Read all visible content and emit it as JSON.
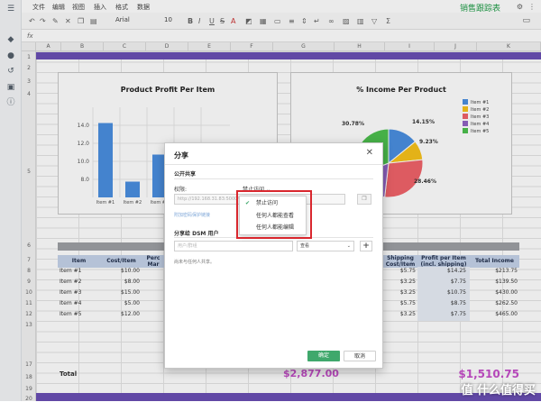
{
  "app": {
    "doc_title": "销售跟踪表"
  },
  "menu": [
    "文件",
    "编辑",
    "视图",
    "插入",
    "格式",
    "数据"
  ],
  "toolbar": {
    "font": "Arial",
    "size": "10"
  },
  "formula_bar": {
    "fx": "fx"
  },
  "columns": [
    "A",
    "B",
    "C",
    "D",
    "E",
    "F",
    "G",
    "H",
    "I",
    "J",
    "K"
  ],
  "rows": [
    "1",
    "2",
    "3",
    "4",
    "5",
    "6",
    "7",
    "8",
    "9",
    "10",
    "11",
    "12",
    "13",
    "17",
    "18",
    "19",
    "20"
  ],
  "chart_left": {
    "title": "Product Profit Per Item",
    "chart_data": {
      "type": "bar",
      "categories": [
        "Item #1",
        "Item #2",
        "Item #3"
      ],
      "values": [
        14.25,
        7.75,
        10.75
      ],
      "ylim": [
        6,
        16
      ],
      "yticks": [
        "14.0",
        "12.0",
        "10.0",
        "8.0"
      ],
      "color": "#4a8fe0"
    }
  },
  "chart_right": {
    "title": "% Income Per Product",
    "chart_data": {
      "type": "pie",
      "labels": [
        "Item #1",
        "Item #2",
        "Item #3",
        "Item #4",
        "Item #5"
      ],
      "values": [
        14.15,
        9.23,
        28.46,
        17.38,
        30.78
      ],
      "colors": [
        "#4a8fe0",
        "#f7c21b",
        "#f0636a",
        "#9163c4",
        "#4cbf4e"
      ],
      "data_labels": [
        "14.15%",
        "9.23%",
        "28.46%",
        "30.78%"
      ]
    }
  },
  "table": {
    "headers_left": [
      "Item",
      "Cost/Item",
      "Perc",
      "Mar"
    ],
    "headers_right": [
      "Shipping\nCost/Item",
      "Profit per Item\n(incl. shipping)",
      "Total Income"
    ],
    "rows": [
      {
        "item": "Item #1",
        "cost": "$10.00",
        "ship": "$5.75",
        "profit": "$14.25",
        "income": "$213.75"
      },
      {
        "item": "Item #2",
        "cost": "$8.00",
        "ship": "$3.25",
        "profit": "$7.75",
        "income": "$139.50"
      },
      {
        "item": "Item #3",
        "cost": "$15.00",
        "ship": "$3.25",
        "profit": "$10.75",
        "income": "$430.00"
      },
      {
        "item": "Item #4",
        "cost": "$5.00",
        "ship": "$5.75",
        "profit": "$8.75",
        "income": "$262.50"
      },
      {
        "item": "Item #5",
        "cost": "$12.00",
        "ship": "$3.25",
        "profit": "$7.75",
        "income": "$465.00"
      }
    ],
    "total_label": "Total",
    "total_mid": "$2,877.00",
    "total_right": "$1,510.75"
  },
  "dialog": {
    "title": "分享",
    "section_public": "公开共享",
    "perm_label": "权限:",
    "perm_value": "禁止访问",
    "link_value": "http://192.168.31.83:5000/...6d5489d670a65",
    "link_hint": "附加密码保护链接",
    "section_dsm": "分享给 DSM 用户",
    "user_placeholder": "用户/群组",
    "role_value": "查看",
    "no_share": "尚未与任何人共享。",
    "ok": "确定",
    "cancel": "取消"
  },
  "perm_menu": [
    "禁止访问",
    "任何人都能查看",
    "任何人都能编辑"
  ],
  "watermark": "值 什么值得买"
}
